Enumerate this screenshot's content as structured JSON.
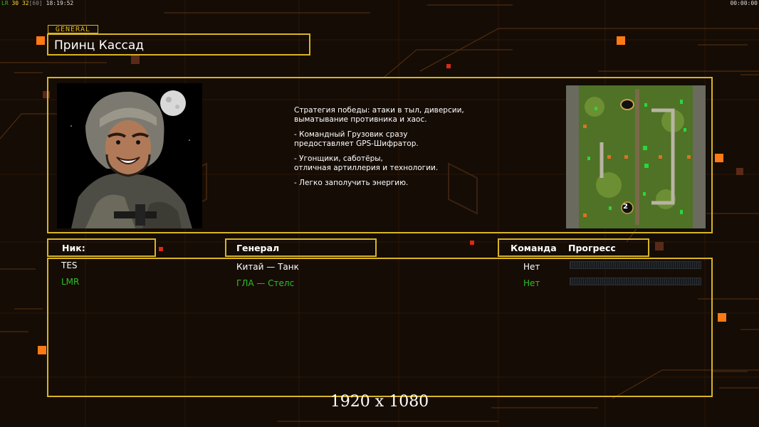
{
  "hud": {
    "fps_left": "LR",
    "fps_a": "30",
    "fps_b": "32",
    "fps_c": "[60]",
    "clock": "18:19:52",
    "timer": "00:00:00"
  },
  "general_tab": "GENERAL",
  "general_name": "Принц Кассад",
  "description": [
    "Стратегия победы: атаки в тыл, диверсии,",
    " выматывание противника и хаос.",
    "",
    "- Командный Грузовик сразу",
    "предоставляет GPS-Шифратор.",
    "",
    "- Угонщики, саботёры,",
    "отличная артиллерия и технологии.",
    "",
    "- Легко заполучить энергию."
  ],
  "map_marker": "2",
  "headers": {
    "nick": "Ник:",
    "general": "Генерал",
    "team": "Команда",
    "progress": "Прогресс"
  },
  "players": [
    {
      "nick": "TES",
      "general": "Китай — Танк",
      "team": "Нет",
      "color": "#ffffff"
    },
    {
      "nick": "LMR",
      "general": "ГЛА — Стелс",
      "team": "Нет",
      "color": "#2fbf2a"
    }
  ],
  "resolution_caption": "1920 x 1080",
  "colors": {
    "accent": "#d8b422",
    "orange": "#ff7a14",
    "green": "#2fbf2a"
  }
}
